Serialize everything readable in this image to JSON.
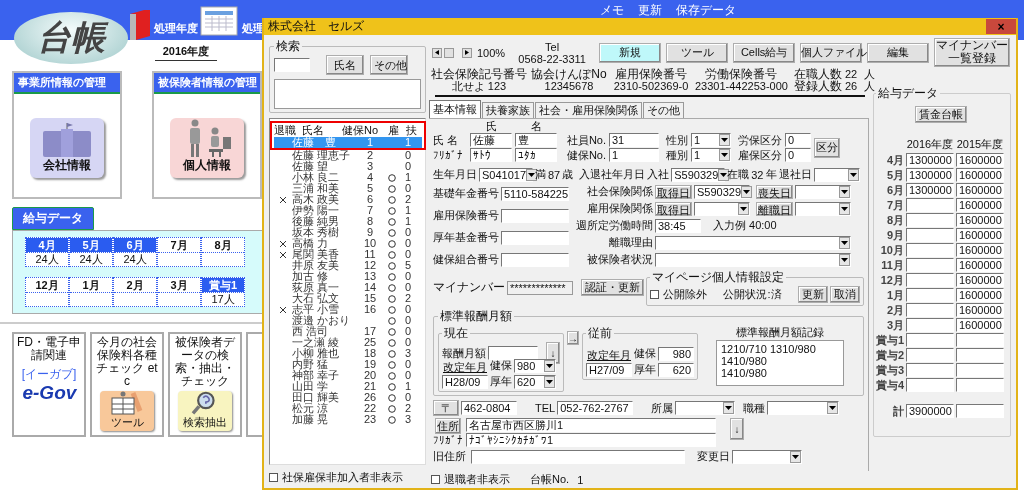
{
  "app": {
    "logo": "台帳",
    "header_labels": [
      "処理年度",
      "処理"
    ],
    "top_labels": [
      "メモ",
      "更新",
      "保存データ"
    ],
    "year": "2016年度",
    "panels": [
      {
        "title": "事業所情報の管理",
        "button": "会社情報",
        "kind": "building"
      },
      {
        "title": "被保険者情報の管理",
        "button": "個人情報",
        "kind": "people"
      }
    ],
    "salary": {
      "title": "給与データ",
      "rows": [
        [
          {
            "label": "4月",
            "selected": true,
            "count": "24人"
          },
          {
            "label": "5月",
            "selected": true,
            "count": "24人"
          },
          {
            "label": "6月",
            "selected": true,
            "count": "24人"
          },
          {
            "label": "7月",
            "selected": false
          },
          {
            "label": "8月",
            "selected": false
          }
        ],
        [
          {
            "label": "12月",
            "selected": false
          },
          {
            "label": "1月",
            "selected": false
          },
          {
            "label": "2月",
            "selected": false
          },
          {
            "label": "3月",
            "selected": false
          },
          {
            "label": "賞与1",
            "selected": true,
            "count": "17人"
          }
        ]
      ]
    },
    "tiles": [
      {
        "kind": "egov",
        "caption": "FD・電子申請関連",
        "logo": "e-Gov",
        "logo_note": "[イーガブ]"
      },
      {
        "kind": "tool",
        "caption": "今月の社会保険料各種チェック etc",
        "button": "ツール"
      },
      {
        "kind": "search",
        "caption": "被保険者データの検索・抽出・チェック",
        "button": "検索抽出"
      },
      {
        "kind": "partial"
      }
    ]
  },
  "dialog": {
    "title": "株式会社　セルズ",
    "close": "×",
    "search": {
      "legend": "検索",
      "buttons": [
        "氏名",
        "その他"
      ]
    },
    "list": {
      "columns": [
        "退職",
        "氏名",
        "健保No",
        "雇",
        "扶"
      ],
      "rows": [
        {
          "selected": true,
          "retired": false,
          "name": "佐藤　豊",
          "no": "1",
          "koyo": false,
          "fu": "1"
        },
        {
          "selected": false,
          "retired": false,
          "name": "佐藤 理恵子",
          "no": "2",
          "koyo": false,
          "fu": "0"
        },
        {
          "selected": false,
          "retired": false,
          "name": "佐藤 望",
          "no": "3",
          "koyo": false,
          "fu": "0"
        },
        {
          "selected": false,
          "retired": false,
          "name": "小林 良二",
          "no": "4",
          "koyo": true,
          "fu": "1"
        },
        {
          "selected": false,
          "retired": false,
          "name": "三浦 和美",
          "no": "5",
          "koyo": true,
          "fu": "0"
        },
        {
          "selected": false,
          "retired": true,
          "name": "高木 政美",
          "no": "6",
          "koyo": true,
          "fu": "2"
        },
        {
          "selected": false,
          "retired": false,
          "name": "伊勢 陽一",
          "no": "7",
          "koyo": true,
          "fu": "1"
        },
        {
          "selected": false,
          "retired": false,
          "name": "後藤 純男",
          "no": "8",
          "koyo": true,
          "fu": "1"
        },
        {
          "selected": false,
          "retired": false,
          "name": "坂本 秀樹",
          "no": "9",
          "koyo": true,
          "fu": "0"
        },
        {
          "selected": false,
          "retired": true,
          "name": "高橋 力",
          "no": "10",
          "koyo": true,
          "fu": "0"
        },
        {
          "selected": false,
          "retired": true,
          "name": "尾関 美香",
          "no": "11",
          "koyo": true,
          "fu": "0"
        },
        {
          "selected": false,
          "retired": false,
          "name": "井原 友美",
          "no": "12",
          "koyo": true,
          "fu": "5"
        },
        {
          "selected": false,
          "retired": false,
          "name": "加古 修",
          "no": "13",
          "koyo": true,
          "fu": "0"
        },
        {
          "selected": false,
          "retired": false,
          "name": "荻原 真一",
          "no": "14",
          "koyo": true,
          "fu": "0"
        },
        {
          "selected": false,
          "retired": false,
          "name": "大石 弘文",
          "no": "15",
          "koyo": true,
          "fu": "2"
        },
        {
          "selected": false,
          "retired": true,
          "name": "志平 小雪",
          "no": "16",
          "koyo": true,
          "fu": "0"
        },
        {
          "selected": false,
          "retired": false,
          "name": "渡邉 かおり",
          "koyo": true,
          "fu": "0"
        },
        {
          "selected": false,
          "retired": false,
          "name": "西 浩司",
          "no": "17",
          "koyo": true,
          "fu": "0"
        },
        {
          "selected": false,
          "retired": false,
          "name": "一之瀬 綾",
          "no": "25",
          "koyo": true,
          "fu": "0"
        },
        {
          "selected": false,
          "retired": false,
          "name": "小柳 雅也",
          "no": "18",
          "koyo": true,
          "fu": "3"
        },
        {
          "selected": false,
          "retired": false,
          "name": "内野 猛",
          "no": "19",
          "koyo": true,
          "fu": "0"
        },
        {
          "selected": false,
          "retired": false,
          "name": "神部 幸子",
          "no": "20",
          "koyo": true,
          "fu": "0"
        },
        {
          "selected": false,
          "retired": false,
          "name": "山田 学",
          "no": "21",
          "koyo": true,
          "fu": "1"
        },
        {
          "selected": false,
          "retired": false,
          "name": "田口 輝美",
          "no": "26",
          "koyo": true,
          "fu": "0"
        },
        {
          "selected": false,
          "retired": false,
          "name": "松元 涼",
          "no": "22",
          "koyo": true,
          "fu": "2"
        },
        {
          "selected": false,
          "retired": false,
          "name": "加藤 晃",
          "no": "23",
          "koyo": true,
          "fu": "3"
        }
      ]
    },
    "left_checkbox": {
      "label": "社保雇保非加入者非表示",
      "checked": false
    },
    "zoom": "100%",
    "tel": {
      "label": "Tel",
      "value": "0568-22-3311"
    },
    "toolbar": [
      {
        "label": "新規",
        "highlighted": true
      },
      {
        "label": "ツール",
        "highlighted": false
      },
      {
        "label": "Cells給与",
        "highlighted": false
      },
      {
        "label": "個人ファイル",
        "highlighted": false
      },
      {
        "label": "編集",
        "highlighted": false
      },
      {
        "label": "マイナンバー一覧登録",
        "highlighted": false
      }
    ],
    "info": [
      {
        "label": "社会保険記号番号",
        "value": "北せよ 123"
      },
      {
        "label": "協会けんぽNo",
        "value": "12345678"
      },
      {
        "label": "雇用保険番号",
        "value": "2310-502369-0"
      },
      {
        "label": "労働保険番号",
        "value": "23301-442253-000"
      }
    ],
    "counts": [
      {
        "label": "在職人数",
        "value": "22",
        "unit": "人"
      },
      {
        "label": "登録人数",
        "value": "26",
        "unit": "人"
      }
    ],
    "tabs": [
      {
        "label": "基本情報",
        "selected": true
      },
      {
        "label": "扶養家族",
        "selected": false
      },
      {
        "label": "社会・雇用保険関係",
        "selected": false
      },
      {
        "label": "その他",
        "selected": false
      }
    ],
    "form": {
      "name": {
        "label": "氏 名",
        "headers": [
          "氏",
          "名"
        ],
        "values": [
          "佐藤",
          "豊"
        ],
        "kana_label": "ﾌﾘｶﾞﾅ",
        "kana": [
          "ｻﾄｳ",
          "ﾕﾀｶ"
        ]
      },
      "ids": [
        {
          "label": "社員No.",
          "value": "31"
        },
        {
          "label": "健保No.",
          "value": "1"
        }
      ],
      "selects": [
        {
          "label": "性別",
          "value": "1"
        },
        {
          "label": "種別",
          "value": "1"
        }
      ],
      "divisions": [
        {
          "label": "労保区分",
          "value": "0"
        },
        {
          "label": "雇保区分",
          "value": "0"
        }
      ],
      "division_button": "区分",
      "birth": {
        "label": "生年月日",
        "value": "S041017",
        "age_prefix": "満",
        "age": "87",
        "age_unit": "歳"
      },
      "join": {
        "label": "入退社年月日",
        "sub": "入社",
        "value": "S590329",
        "tenure_prefix": "在職",
        "tenure": "32",
        "tenure_unit": "年",
        "leave_label": "退社日"
      },
      "left_fields": [
        {
          "label": "基礎年金番号",
          "value": "5110-584225"
        },
        {
          "label": "雇用保険番号"
        },
        {
          "label": "厚年基金番号"
        },
        {
          "label": "健保組合番号"
        }
      ],
      "insurance": [
        {
          "label": "社会保険関係",
          "get": "取得日",
          "get_value": "S590329",
          "lose": "喪失日"
        },
        {
          "label": "雇用保険関係",
          "get": "取得日",
          "lose": "離職日"
        }
      ],
      "hours": {
        "label": "週所定労働時間",
        "value": "38:45",
        "example": "入力例  40:00"
      },
      "reasons": [
        {
          "label": "離職理由"
        },
        {
          "label": "被保険者状況"
        }
      ],
      "mynumber": {
        "label": "マイナンバー",
        "value": "*************",
        "button": "認証・更新"
      },
      "mypage": {
        "legend": "マイページ個人情報設定",
        "checkbox": {
          "label": "公開除外",
          "checked": false
        },
        "status": "公開状況:済",
        "buttons": [
          "更新",
          "取消"
        ]
      },
      "standard": {
        "legend": "標準報酬月額",
        "current": {
          "legend": "現在",
          "amount_label": "報酬月額",
          "down": "↓",
          "date_label": "改定年月",
          "date": "H28/09",
          "health_label": "健保",
          "health": "980",
          "pension_label": "厚年",
          "pension": "620"
        },
        "copy": "→",
        "previous": {
          "legend": "従前",
          "date_label": "改定年月",
          "date": "H27/09",
          "health_label": "健保",
          "health": "980",
          "pension_label": "厚年",
          "pension": "620"
        },
        "record": {
          "legend": "標準報酬月額記録",
          "value": "1210/710  1310/980 1410/980\n1410/980"
        }
      },
      "address": {
        "zip_button": "〒",
        "zip": "462-0804",
        "tel_label": "TEL",
        "tel": "052-762-2767",
        "dept_label": "所属",
        "job_label": "職種",
        "address_button": "住所",
        "address": "名古屋市西区勝川1",
        "kana_label": "ﾌﾘｶﾞﾅ",
        "kana": "ﾅｺﾞﾔｼﾆｼｸｶﾁｶﾞﾜ1",
        "down": "↓",
        "old_label": "旧住所",
        "changed_label": "変更日"
      }
    },
    "salary_panel": {
      "legend": "給与データ",
      "button": "賃金台帳",
      "columns": [
        "2016年度",
        "2015年度"
      ],
      "rows": [
        {
          "label": "4月",
          "fy2016": "1300000",
          "fy2015": "1600000"
        },
        {
          "label": "5月",
          "fy2016": "1300000",
          "fy2015": "1600000"
        },
        {
          "label": "6月",
          "fy2016": "1300000",
          "fy2015": "1600000"
        },
        {
          "label": "7月",
          "fy2015": "1600000"
        },
        {
          "label": "8月",
          "fy2015": "1600000"
        },
        {
          "label": "9月",
          "fy2015": "1600000"
        },
        {
          "label": "10月",
          "fy2015": "1600000"
        },
        {
          "label": "11月",
          "fy2015": "1600000"
        },
        {
          "label": "12月",
          "fy2015": "1600000"
        },
        {
          "label": "1月",
          "fy2015": "1600000"
        },
        {
          "label": "2月",
          "fy2015": "1600000"
        },
        {
          "label": "3月",
          "fy2015": "1600000"
        },
        {
          "label": "賞与1"
        },
        {
          "label": "賞与2"
        },
        {
          "label": "賞与3"
        },
        {
          "label": "賞与4"
        }
      ],
      "total": {
        "label": "計",
        "fy2016": "3900000"
      }
    },
    "footer": {
      "checkbox": {
        "label": "退職者非表示",
        "checked": false
      },
      "ledger_label": "台帳No.",
      "ledger_no": "1"
    }
  }
}
